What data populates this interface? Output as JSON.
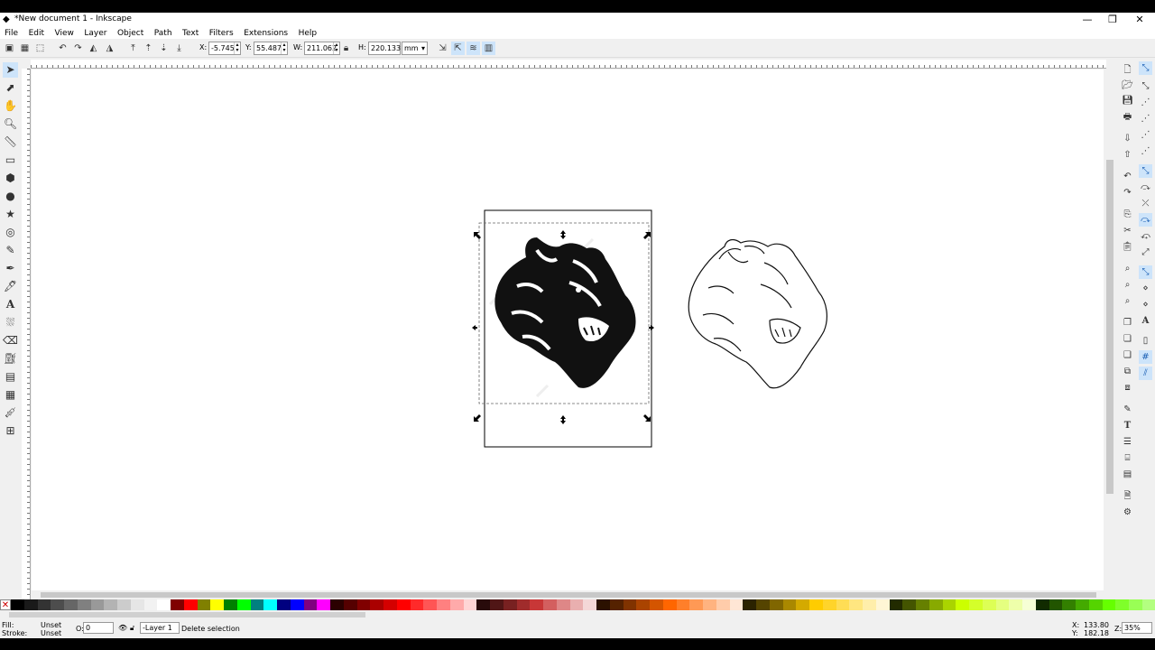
{
  "window": {
    "title": "*New document 1 - Inkscape",
    "minimize": "—",
    "restore": "❐",
    "close": "✕"
  },
  "menu": [
    "File",
    "Edit",
    "View",
    "Layer",
    "Object",
    "Path",
    "Text",
    "Filters",
    "Extensions",
    "Help"
  ],
  "tool_controls": {
    "x_label": "X:",
    "x_value": "-5.745",
    "y_label": "Y:",
    "y_value": "55.487",
    "w_label": "W:",
    "w_value": "211.062",
    "h_label": "H:",
    "h_value": "220.133",
    "unit": "mm"
  },
  "status": {
    "fill_label": "Fill:",
    "fill_value": "Unset",
    "stroke_label": "Stroke:",
    "stroke_value": "Unset",
    "opacity_label": "O:",
    "opacity_value": "0",
    "layer": "-Layer 1",
    "message": "Delete selection",
    "cursor_x_label": "X:",
    "cursor_x": "133.80",
    "cursor_y_label": "Y:",
    "cursor_y": "182.18",
    "zoom_label": "Z:",
    "zoom": "35%"
  },
  "palette": [
    "#000000",
    "#1a1a1a",
    "#333333",
    "#4d4d4d",
    "#666666",
    "#808080",
    "#999999",
    "#b3b3b3",
    "#cccccc",
    "#e6e6e6",
    "#f2f2f2",
    "#ffffff",
    "#800000",
    "#ff0000",
    "#808000",
    "#ffff00",
    "#008000",
    "#00ff00",
    "#008080",
    "#00ffff",
    "#000080",
    "#0000ff",
    "#800080",
    "#ff00ff",
    "#2b0000",
    "#550000",
    "#800000",
    "#aa0000",
    "#d40000",
    "#ff0000",
    "#ff2a2a",
    "#ff5555",
    "#ff8080",
    "#ffaaaa",
    "#ffd5d5",
    "#280b0b",
    "#501616",
    "#782121",
    "#a02c2c",
    "#c83737",
    "#d35f5f",
    "#de8787",
    "#e9afaf",
    "#f4d7d7",
    "#2b1100",
    "#552200",
    "#803300",
    "#aa4400",
    "#d45500",
    "#ff6600",
    "#ff7f2a",
    "#ff9955",
    "#ffb380",
    "#ffccaa",
    "#ffe6d5",
    "#2b2200",
    "#554400",
    "#806600",
    "#aa8800",
    "#d4aa00",
    "#ffcc00",
    "#ffd42a",
    "#ffdd55",
    "#ffe680",
    "#ffeeaa",
    "#fff6d5",
    "#222b00",
    "#445500",
    "#668000",
    "#88aa00",
    "#aad400",
    "#ccff00",
    "#d4ff2a",
    "#ddff55",
    "#e5ff80",
    "#eeffaa",
    "#f6ffd5",
    "#112b00",
    "#225500",
    "#338000",
    "#44aa00",
    "#55d400",
    "#66ff00",
    "#7fff2a",
    "#99ff55",
    "#b3ff80"
  ]
}
